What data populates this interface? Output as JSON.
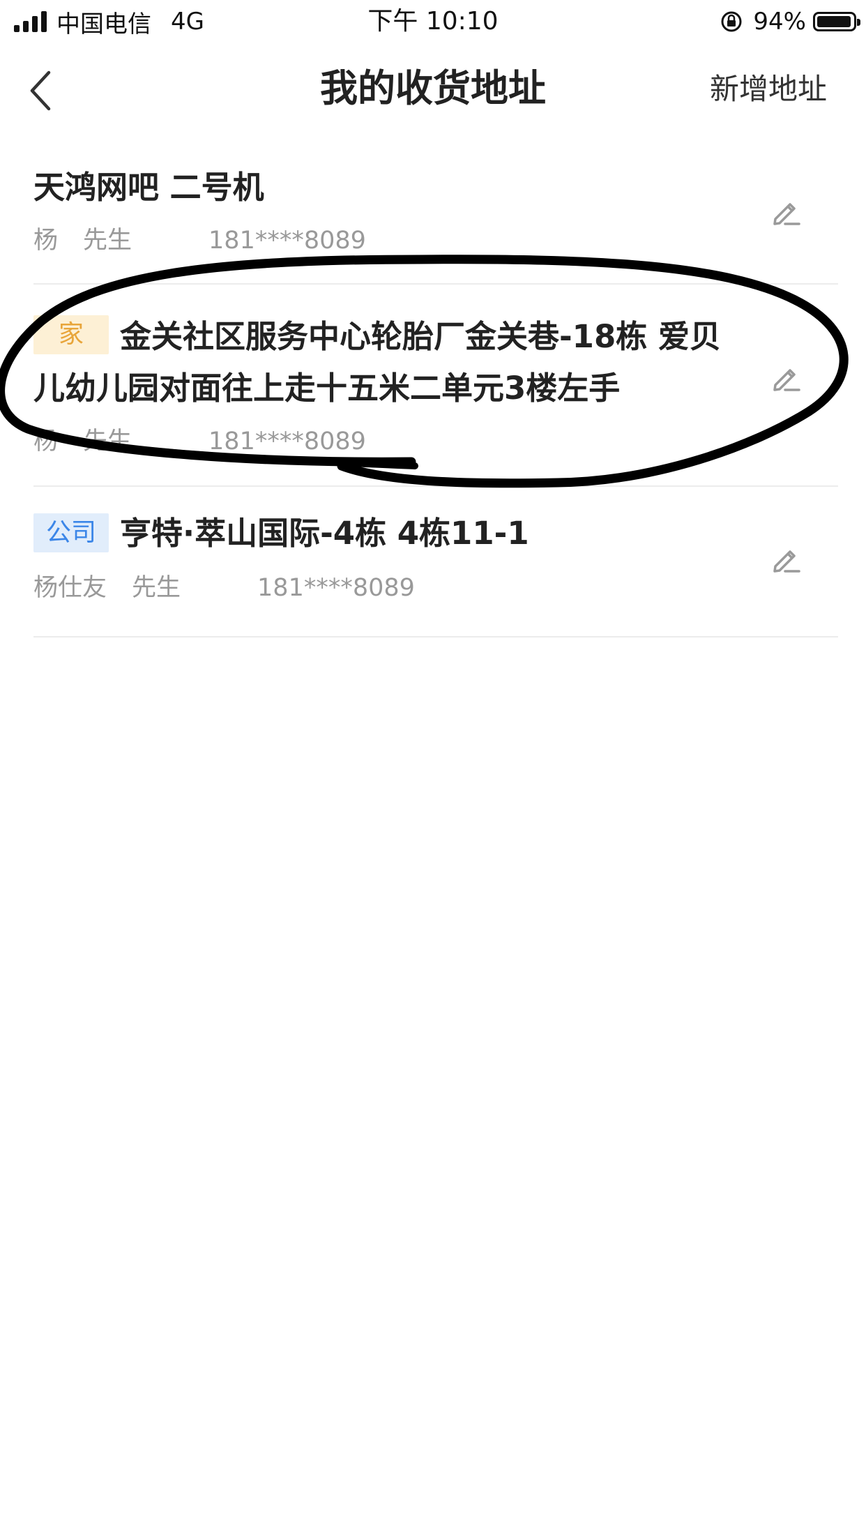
{
  "status_bar": {
    "carrier": "中国电信",
    "network": "4G",
    "time": "下午 10:10",
    "battery": "94%"
  },
  "nav": {
    "title": "我的收货地址",
    "add_label": "新增地址",
    "back_icon": "chevron-left-icon"
  },
  "addresses": [
    {
      "tag": "",
      "address": "天鸿网吧 二号机",
      "name": "杨",
      "title": "先生",
      "phone": "181****8089"
    },
    {
      "tag": "家",
      "address": "金关社区服务中心轮胎厂金关巷-18栋 爱贝儿幼儿园对面往上走十五米二单元3楼左手",
      "name": "杨",
      "title": "先生",
      "phone": "181****8089"
    },
    {
      "tag": "公司",
      "address": "亨特·萃山国际-4栋 4栋11-1",
      "name": "杨仕友",
      "title": "先生",
      "phone": "181****8089"
    }
  ],
  "colors": {
    "home_tag_bg": "#fdf0d5",
    "home_tag_text": "#e8a53a",
    "company_tag_bg": "#e1edfb",
    "company_tag_text": "#3b86e8",
    "annotation_stroke": "#000000"
  }
}
